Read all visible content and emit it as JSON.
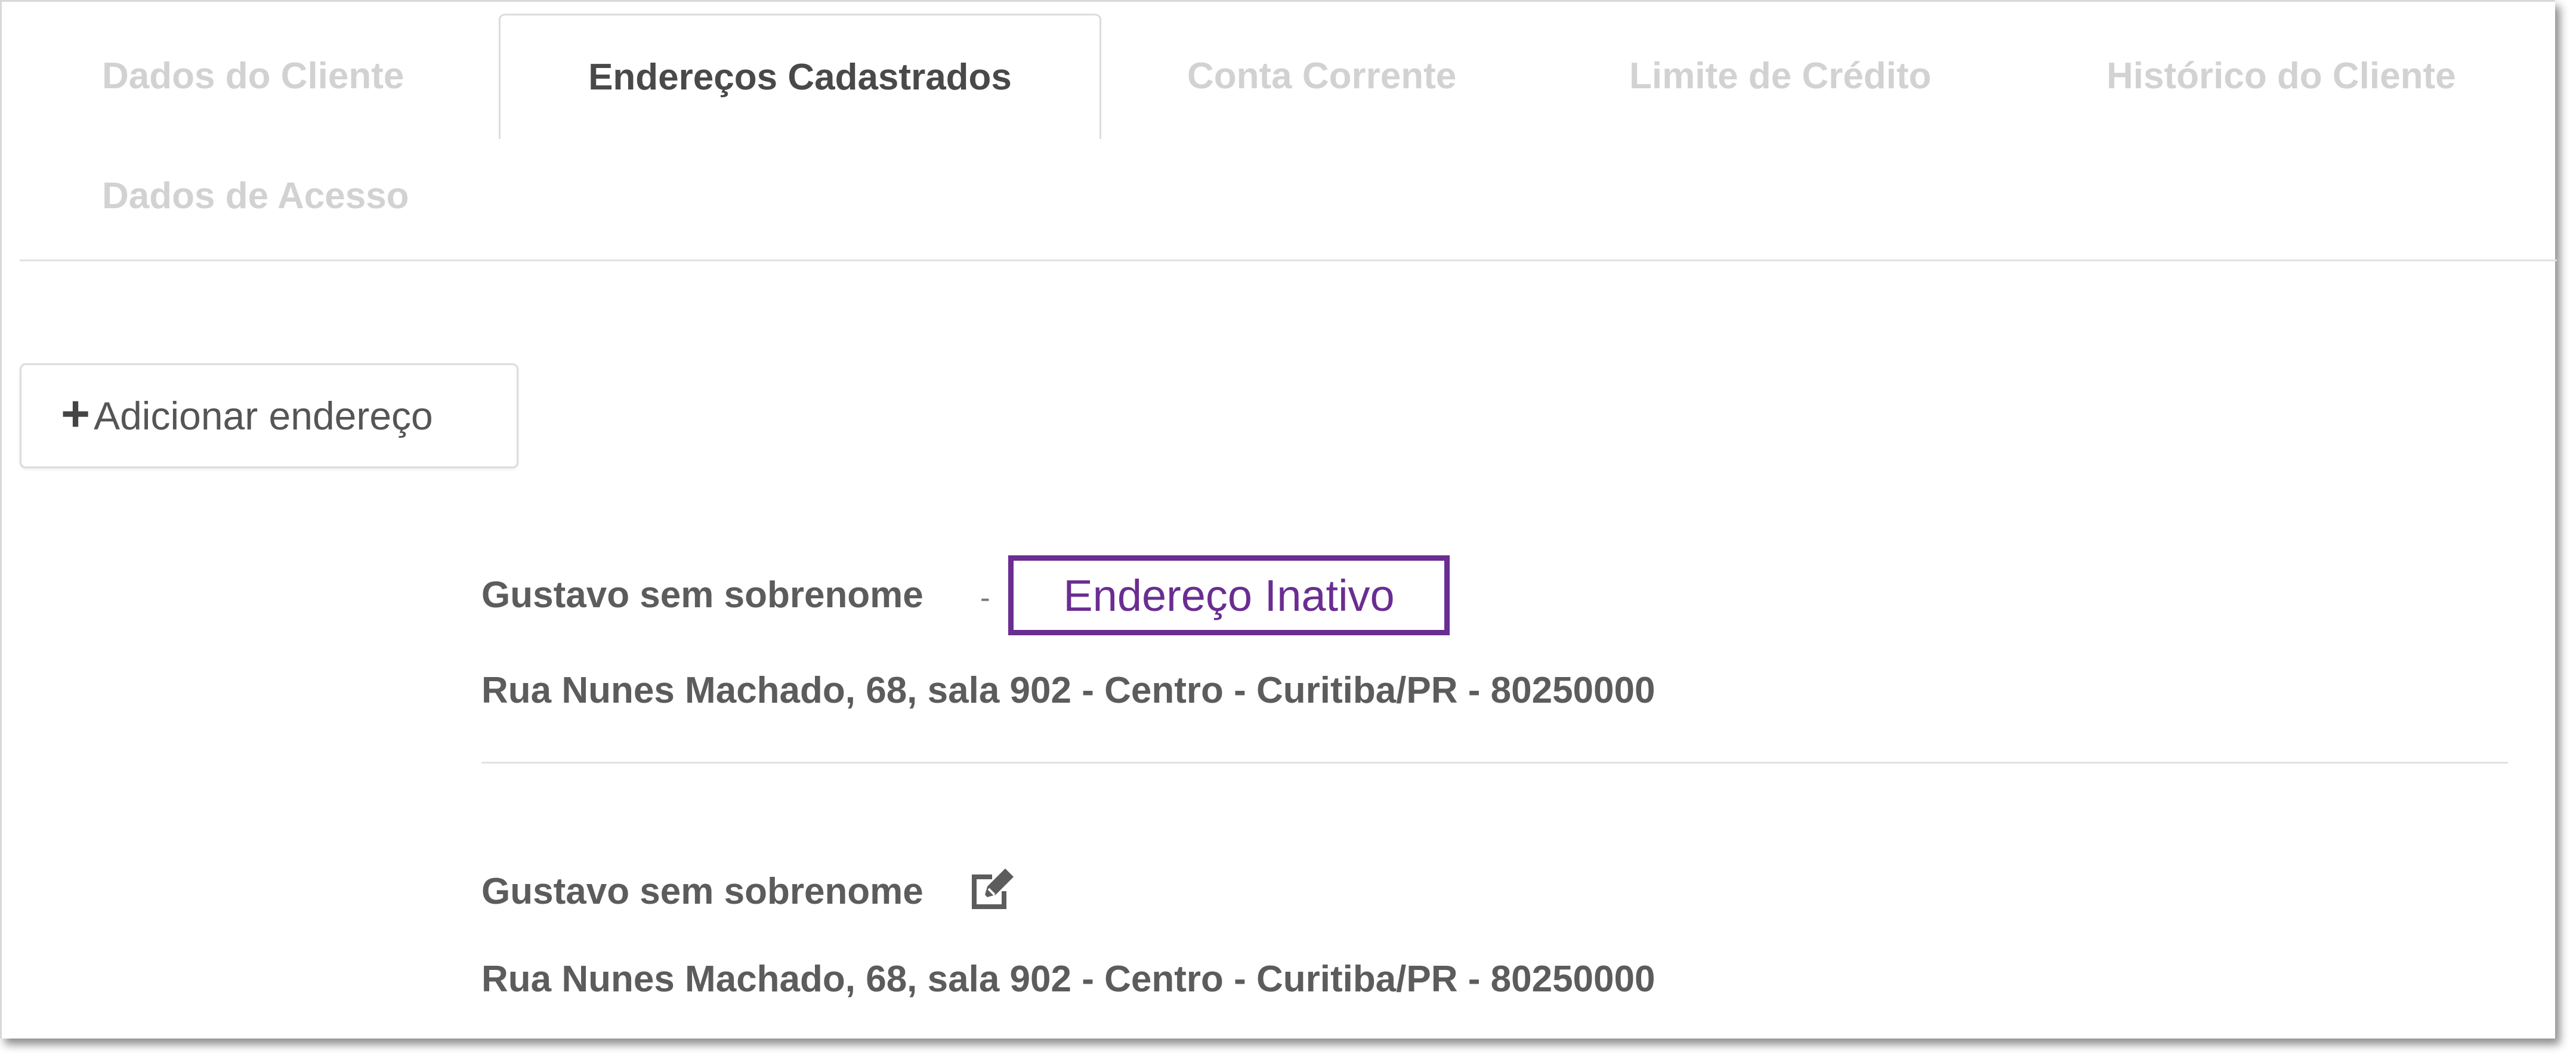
{
  "tabs": [
    {
      "label": "Dados do Cliente",
      "active": false
    },
    {
      "label": "Endereços Cadastrados",
      "active": true
    },
    {
      "label": "Conta Corrente",
      "active": false
    },
    {
      "label": "Limite de Crédito",
      "active": false
    },
    {
      "label": "Histórico do Cliente",
      "active": false
    },
    {
      "label": "Dados de Acesso",
      "active": false
    }
  ],
  "add_address_button": {
    "icon": "plus-icon",
    "label": "Adicionar endereço"
  },
  "addresses": [
    {
      "name": "Gustavo sem sobrenome",
      "separator": "-",
      "status_label": "Endereço Inativo",
      "address": "Rua Nunes Machado, 68, sala 902 - Centro - Curitiba/PR - 80250000"
    },
    {
      "name": "Gustavo sem sobrenome",
      "icon": "edit-icon",
      "address": "Rua Nunes Machado, 68, sala 902 - Centro - Curitiba/PR - 80250000"
    }
  ],
  "colors": {
    "active_tab_text": "#494949",
    "inactive_tab_text": "#d2d2d2",
    "body_text": "#5c5c5c",
    "highlight": "#6a2d91"
  }
}
